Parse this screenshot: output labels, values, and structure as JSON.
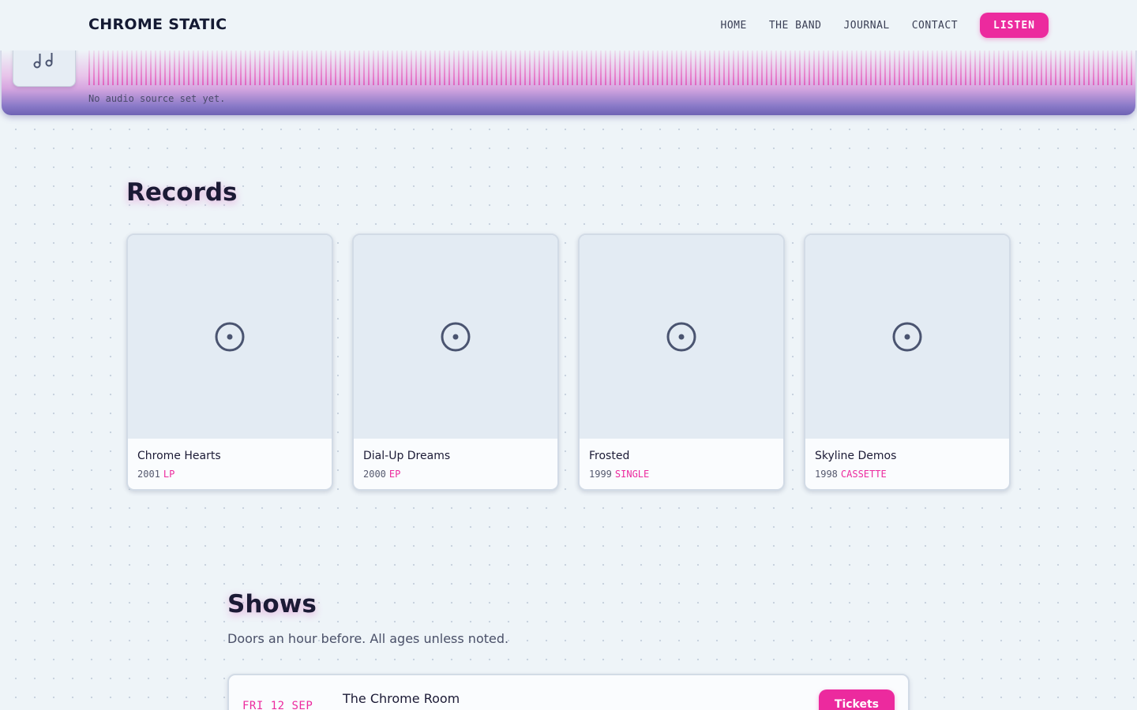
{
  "header": {
    "brand": "CHROME STATIC",
    "nav": [
      "HOME",
      "THE BAND",
      "JOURNAL",
      "CONTACT"
    ],
    "cta_label": "LISTEN"
  },
  "player": {
    "status": "No audio source set yet.",
    "thumb_icon": "music-notes-icon"
  },
  "records": {
    "title": "Records",
    "items": [
      {
        "title": "Chrome Hearts",
        "year": "2001",
        "format": "LP",
        "icon": "disc-icon"
      },
      {
        "title": "Dial-Up Dreams",
        "year": "2000",
        "format": "EP",
        "icon": "disc-icon"
      },
      {
        "title": "Frosted",
        "year": "1999",
        "format": "SINGLE",
        "icon": "disc-icon"
      },
      {
        "title": "Skyline Demos",
        "year": "1998",
        "format": "CASSETTE",
        "icon": "disc-icon"
      }
    ]
  },
  "shows": {
    "title": "Shows",
    "subtitle": "Doors an hour before. All ages unless noted.",
    "items": [
      {
        "date": "FRI 12 SEP",
        "venue": "The Chrome Room",
        "button": "Tickets"
      }
    ]
  },
  "colors": {
    "accent": "#ec2a9e",
    "background": "#eef4f8",
    "text": "#1b1a35",
    "player_gradient_end": "#6e62b4"
  }
}
